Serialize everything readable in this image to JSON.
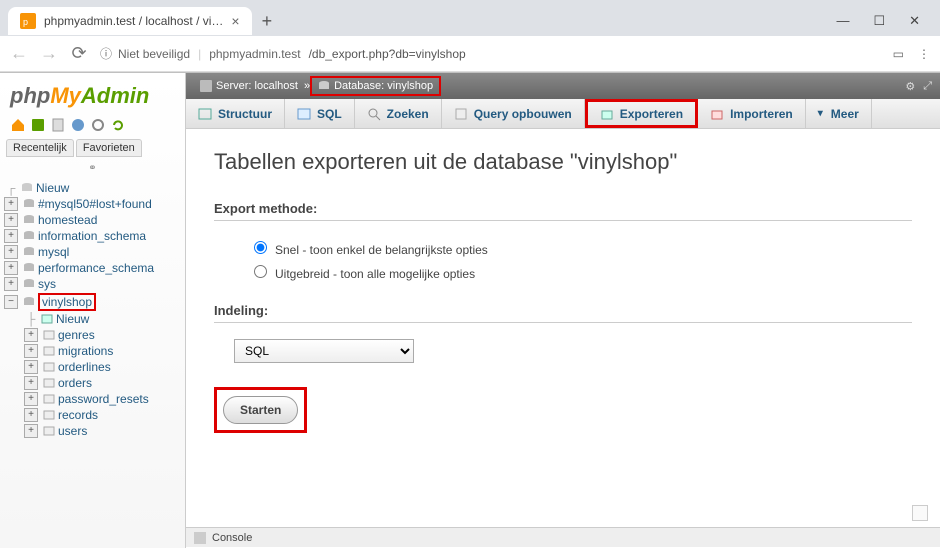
{
  "browser": {
    "tab_title": "phpmyadmin.test / localhost / vi…",
    "url_insecure": "Niet beveiligd",
    "url_host": "phpmyadmin.test",
    "url_path": "/db_export.php?db=vinylshop"
  },
  "logo": {
    "p1": "php",
    "p2": "My",
    "p3": "Admin"
  },
  "sidebar": {
    "tabs": [
      "Recentelijk",
      "Favorieten"
    ],
    "new": "Nieuw",
    "dbs": [
      "#mysql50#lost+found",
      "homestead",
      "information_schema",
      "mysql",
      "performance_schema",
      "sys"
    ],
    "active_db": "vinylshop",
    "active_new": "Nieuw",
    "tables": [
      "genres",
      "migrations",
      "orderlines",
      "orders",
      "password_resets",
      "records",
      "users"
    ]
  },
  "breadcrumb": {
    "server_label": "Server: localhost",
    "db_label": "Database: vinylshop"
  },
  "tabs": {
    "items": [
      "Structuur",
      "SQL",
      "Zoeken",
      "Query opbouwen",
      "Exporteren",
      "Importeren",
      "Meer"
    ]
  },
  "page": {
    "title": "Tabellen exporteren uit de database \"vinylshop\"",
    "export_method_label": "Export methode:",
    "radio_quick": "Snel - toon enkel de belangrijkste opties",
    "radio_custom": "Uitgebreid - toon alle mogelijke opties",
    "format_label": "Indeling:",
    "format_value": "SQL",
    "start_button": "Starten"
  },
  "console": {
    "label": "Console"
  }
}
